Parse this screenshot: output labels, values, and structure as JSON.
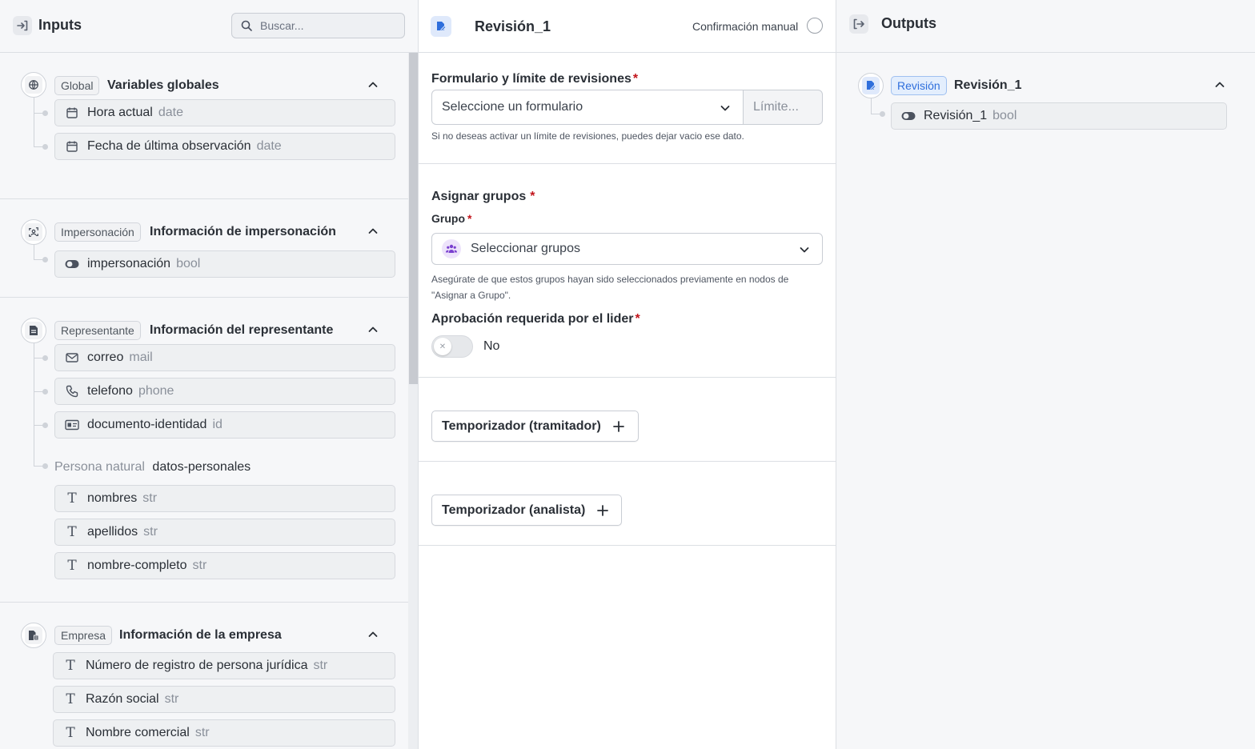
{
  "inputs_panel": {
    "title": "Inputs",
    "search_placeholder": "Buscar...",
    "sections": [
      {
        "tag": "Global",
        "title": "Variables globales",
        "icon": "globe-icon",
        "fields": [
          {
            "name": "Hora actual",
            "type": "date",
            "icon": "calendar-icon"
          },
          {
            "name": "Fecha de última observación",
            "type": "date",
            "icon": "calendar-icon"
          }
        ]
      },
      {
        "tag": "Impersonación",
        "title": "Información de impersonación",
        "icon": "face-scan-icon",
        "fields": [
          {
            "name": "impersonación",
            "type": "bool",
            "icon": "toggle-icon"
          }
        ]
      },
      {
        "tag": "Representante",
        "title": "Información del representante",
        "icon": "document-icon",
        "fields": [
          {
            "name": "correo",
            "type": "mail",
            "icon": "mail-icon"
          },
          {
            "name": "telefono",
            "type": "phone",
            "icon": "phone-icon"
          },
          {
            "name": "documento-identidad",
            "type": "id",
            "icon": "id-card-icon"
          }
        ],
        "subgroup": {
          "label": "Persona natural",
          "name": "datos-personales",
          "fields": [
            {
              "name": "nombres",
              "type": "str",
              "icon": "text-icon"
            },
            {
              "name": "apellidos",
              "type": "str",
              "icon": "text-icon"
            },
            {
              "name": "nombre-completo",
              "type": "str",
              "icon": "text-icon"
            }
          ]
        }
      },
      {
        "tag": "Empresa",
        "title": "Información de la empresa",
        "icon": "building-doc-icon",
        "fields": [
          {
            "name": "Número de registro de persona jurídica",
            "type": "str",
            "icon": "text-icon"
          },
          {
            "name": "Razón social",
            "type": "str",
            "icon": "text-icon"
          },
          {
            "name": "Nombre comercial",
            "type": "str",
            "icon": "text-icon"
          }
        ]
      }
    ]
  },
  "node_panel": {
    "title": "Revisión_1",
    "manual_confirmation_label": "Confirmación manual",
    "form_section": {
      "label": "Formulario y límite de revisiones",
      "required_mark": "*",
      "form_select_placeholder": "Seleccione un formulario",
      "limit_placeholder": "Límite...",
      "help": "Si no deseas activar un límite de revisiones, puedes dejar vacio ese dato."
    },
    "groups_section": {
      "label": "Asignar grupos",
      "required_mark": "*",
      "group_label": "Grupo",
      "group_select_placeholder": "Seleccionar grupos",
      "help_line1": "Asegúrate de que estos grupos hayan sido seleccionados previamente en nodos de",
      "help_line2": "\"Asignar a Grupo\".",
      "approval_label": "Aprobación requerida por el lider",
      "approval_value": "No"
    },
    "timers": [
      {
        "label": "Temporizador (tramitador)"
      },
      {
        "label": "Temporizador (analista)"
      }
    ]
  },
  "outputs_panel": {
    "title": "Outputs",
    "section": {
      "tag": "Revisión",
      "title": "Revisión_1",
      "fields": [
        {
          "name": "Revisión_1",
          "type": "bool",
          "icon": "toggle-icon"
        }
      ]
    }
  },
  "colors": {
    "accent_blue": "#2f6fdc",
    "required_red": "#c2141b",
    "group_purple": "#7a3fcf"
  }
}
